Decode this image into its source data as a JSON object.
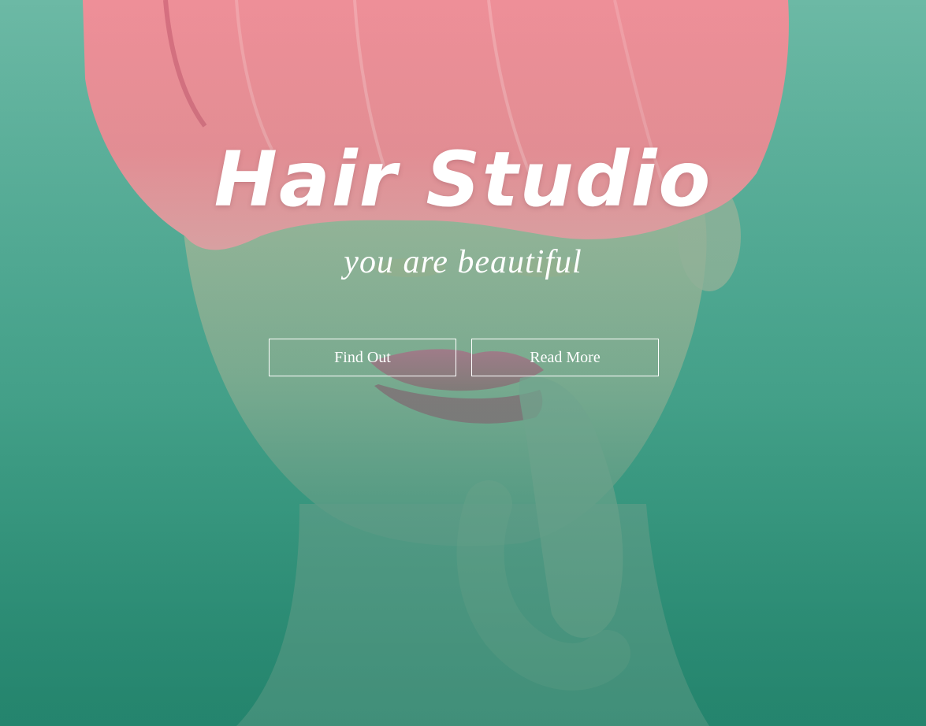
{
  "hero": {
    "title": "Hair Studio",
    "subtitle": "you are beautiful",
    "buttons": {
      "find_out_label": "Find Out",
      "read_more_label": "Read More"
    }
  },
  "colors": {
    "background_top": "#6cb9a5",
    "background_bottom": "#24846d",
    "hair": "#ee8a92",
    "text": "#ffffff"
  }
}
